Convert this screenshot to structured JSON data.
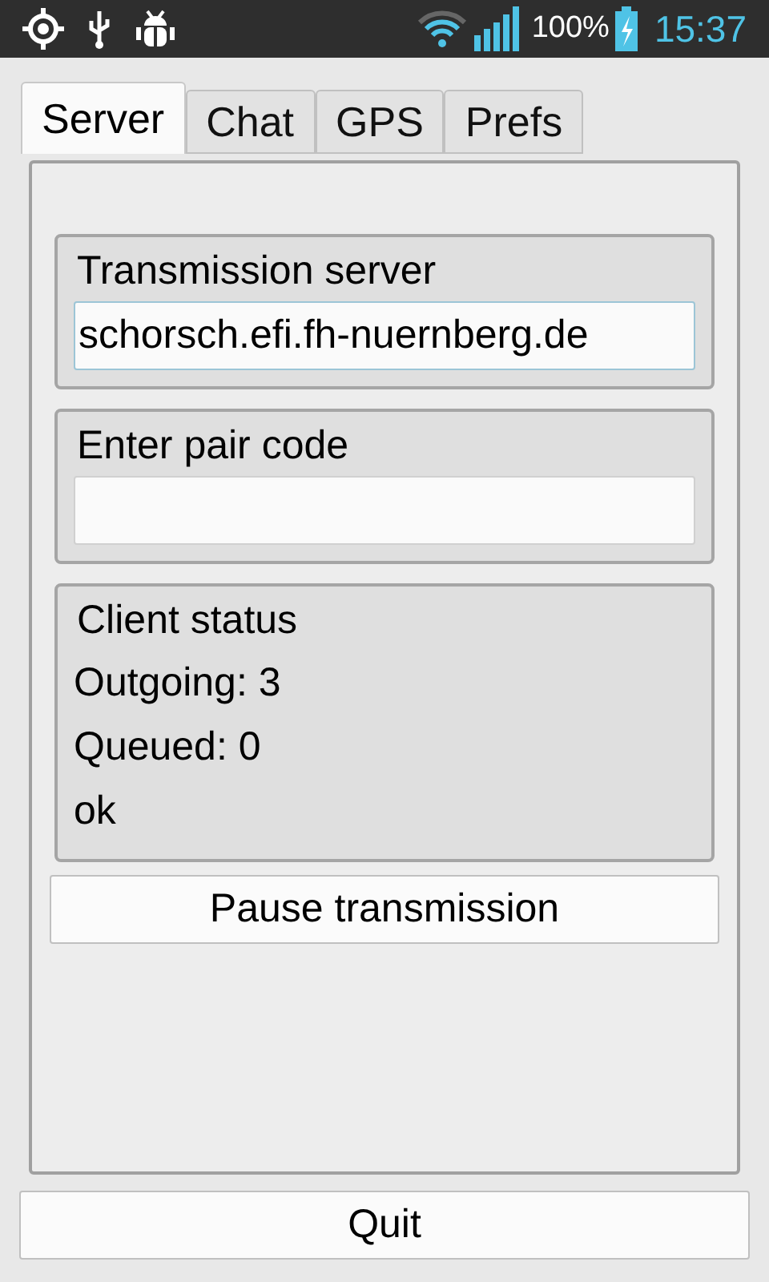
{
  "status_bar": {
    "battery": "100%",
    "time": "15:37"
  },
  "tabs": [
    {
      "label": "Server",
      "selected": true
    },
    {
      "label": "Chat",
      "selected": false
    },
    {
      "label": "GPS",
      "selected": false
    },
    {
      "label": "Prefs",
      "selected": false
    }
  ],
  "server_group": {
    "title": "Transmission server",
    "value": "schorsch.efi.fh-nuernberg.de"
  },
  "pair_group": {
    "title": "Enter pair code"
  },
  "client_status": {
    "title": "Client status",
    "lines": [
      "Outgoing: 3",
      "Queued: 0",
      "ok"
    ]
  },
  "pause_button": "Pause transmission",
  "quit_button": "Quit"
}
